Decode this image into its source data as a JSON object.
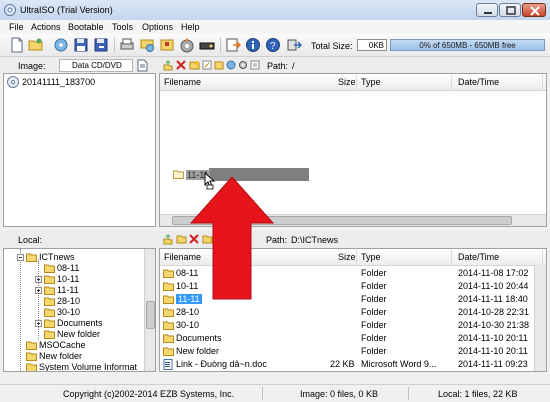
{
  "window": {
    "title": "UltraISO (Trial Version)"
  },
  "menu": [
    "File",
    "Actions",
    "Bootable",
    "Tools",
    "Options",
    "Help"
  ],
  "toolbar": {
    "total_size_label": "Total Size:",
    "total_size_value": "0KB",
    "capacity_text": "0% of 650MB - 650MB free"
  },
  "image_panel": {
    "label": "Image:",
    "type": "Data CD/DVD",
    "path_label": "Path:",
    "path": "/",
    "root": "20141111_183700",
    "columns": [
      "Filename",
      "Size",
      "Type",
      "Date/Time"
    ],
    "dragged_item": "11-11"
  },
  "local_panel": {
    "label": "Local:",
    "path_label": "Path:",
    "path": "D:\\ICTnews",
    "tree": [
      {
        "label": "ICTnews",
        "expand": "minus"
      },
      {
        "label": "08-11",
        "expand": ""
      },
      {
        "label": "10-11",
        "expand": "plus"
      },
      {
        "label": "11-11",
        "expand": "plus"
      },
      {
        "label": "28-10",
        "expand": ""
      },
      {
        "label": "30-10",
        "expand": ""
      },
      {
        "label": "Documents",
        "expand": "plus"
      },
      {
        "label": "New folder",
        "expand": ""
      },
      {
        "label": "MSOCache",
        "expand": ""
      },
      {
        "label": "New folder",
        "expand": ""
      },
      {
        "label": "System Volume Informat",
        "expand": ""
      }
    ],
    "columns": [
      "Filename",
      "Size",
      "Type",
      "Date/Time"
    ],
    "files": [
      {
        "name": "08-11",
        "size": "",
        "type": "Folder",
        "date": "2014-11-08 17:02"
      },
      {
        "name": "10-11",
        "size": "",
        "type": "Folder",
        "date": "2014-11-10 20:44"
      },
      {
        "name": "11-11",
        "size": "",
        "type": "Folder",
        "date": "2014-11-11 18:40"
      },
      {
        "name": "28-10",
        "size": "",
        "type": "Folder",
        "date": "2014-10-28 22:31"
      },
      {
        "name": "30-10",
        "size": "",
        "type": "Folder",
        "date": "2014-10-30 21:38"
      },
      {
        "name": "Documents",
        "size": "",
        "type": "Folder",
        "date": "2014-11-10 20:11"
      },
      {
        "name": "New folder",
        "size": "",
        "type": "Folder",
        "date": "2014-11-10 20:11"
      },
      {
        "name": "Link - Ðuòng dâ~n.doc",
        "size": "22 KB",
        "type": "Microsoft Word 9...",
        "date": "2014-11-11 09:23"
      }
    ]
  },
  "status": {
    "copyright": "Copyright (c)2002-2014 EZB Systems, Inc.",
    "image": "Image: 0 files, 0 KB",
    "local": "Local: 1 files, 22 KB"
  },
  "colors": {
    "arrow": "#e8141b",
    "selection": "#3399ff",
    "drag_bar": "#7f7f7f"
  }
}
